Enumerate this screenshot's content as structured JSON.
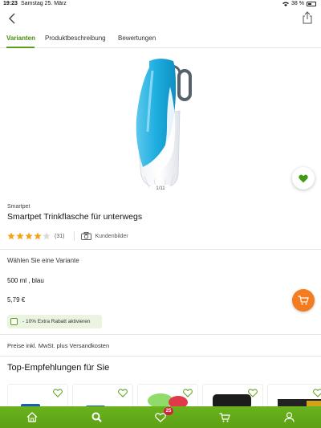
{
  "status_bar": {
    "time": "19:23",
    "date": "Samstag 25. März",
    "battery_text": "38 %",
    "battery_level": 0.38
  },
  "nav": {
    "back_icon": "chevron-left-icon",
    "share_icon": "share-icon"
  },
  "tabs": [
    {
      "label": "Varianten",
      "active": true
    },
    {
      "label": "Produktbeschreibung",
      "active": false
    },
    {
      "label": "Bewertungen",
      "active": false
    }
  ],
  "gallery": {
    "counter": "1/11"
  },
  "product": {
    "brand": "Smartpet",
    "title": "Smartpet Trinkflasche für unterwegs",
    "rating": 4,
    "rating_max": 5,
    "review_count": "(31)",
    "customer_images_label": "Kundenbilder"
  },
  "variant": {
    "heading": "Wählen Sie eine Variante",
    "selected": "500 ml , blau",
    "price": "5,79 €"
  },
  "discount": {
    "label": "- 10%  Extra Rabatt aktivieren",
    "checked": false
  },
  "price_note": "Preise inkl. MwSt. plus Versandkosten",
  "recommendations": {
    "heading": "Top-Empfehlungen für Sie"
  },
  "bottom_nav": {
    "items": [
      "home-icon",
      "search-icon",
      "heart-icon",
      "cart-icon",
      "user-icon"
    ],
    "wishlist_badge": "25"
  },
  "colors": {
    "accent_green": "#5a9e16",
    "cart_orange": "#f47c20",
    "badge_red": "#d4213d",
    "bottle_blue": "#1eaee0"
  }
}
